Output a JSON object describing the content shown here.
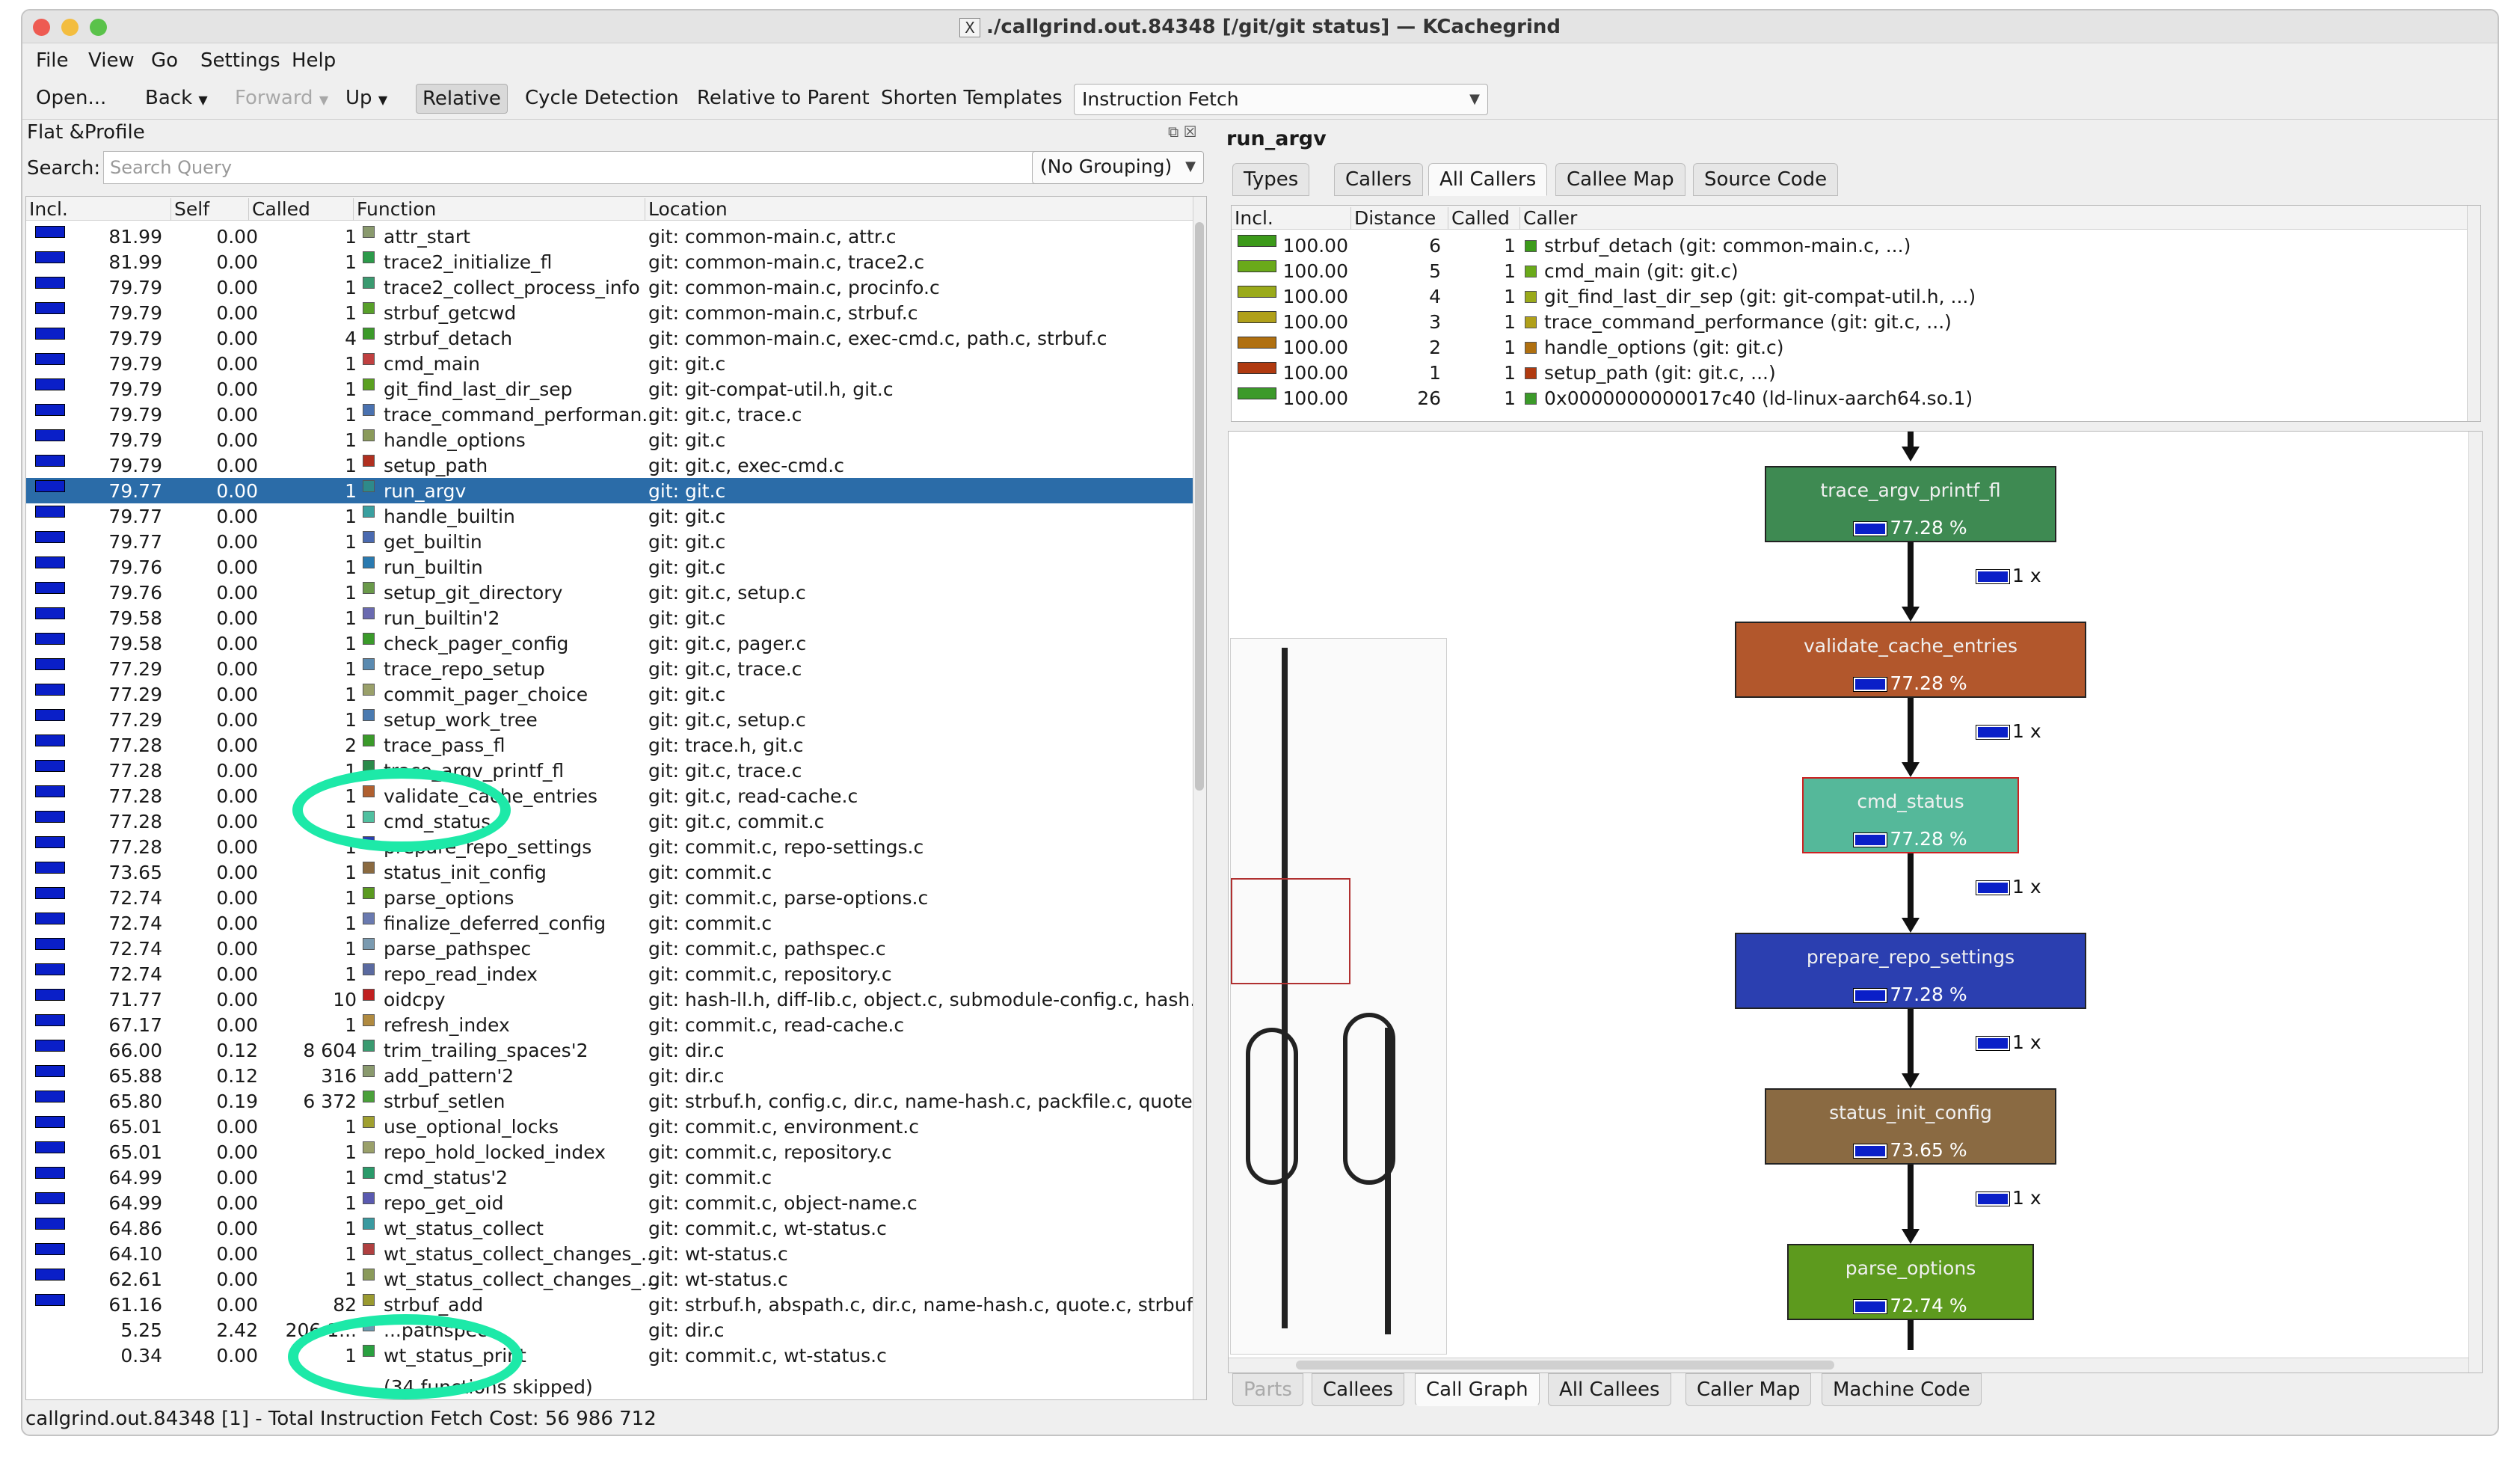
{
  "window": {
    "title": "./callgrind.out.84348 [/git/git status] — KCachegrind",
    "x_glyph": "X"
  },
  "menu": [
    "File",
    "View",
    "Go",
    "Settings",
    "Help"
  ],
  "toolbar": {
    "open": "Open...",
    "back": "Back",
    "forward": "Forward",
    "up": "Up",
    "relative": "Relative",
    "cycle": "Cycle Detection",
    "relative_parent": "Relative to Parent",
    "shorten": "Shorten Templates",
    "event_type": "Instruction Fetch"
  },
  "left": {
    "title": "Flat &Profile",
    "search_label": "Search:",
    "search_placeholder": "Search Query",
    "grouping": "(No Grouping)",
    "headers": [
      "Incl.",
      "Self",
      "Called",
      "Function",
      "Location"
    ],
    "rows": [
      {
        "incl": "81.99",
        "self": "0.00",
        "called": "1",
        "fn": "attr_start",
        "loc": "git: common-main.c, attr.c",
        "color": "#8a9a6e"
      },
      {
        "incl": "81.99",
        "self": "0.00",
        "called": "1",
        "fn": "trace2_initialize_fl",
        "loc": "git: common-main.c, trace2.c",
        "color": "#2c9a4a"
      },
      {
        "incl": "79.79",
        "self": "0.00",
        "called": "1",
        "fn": "trace2_collect_process_info",
        "loc": "git: common-main.c, procinfo.c",
        "color": "#3a9a70"
      },
      {
        "incl": "79.79",
        "self": "0.00",
        "called": "1",
        "fn": "strbuf_getcwd",
        "loc": "git: common-main.c, strbuf.c",
        "color": "#58a02a"
      },
      {
        "incl": "79.79",
        "self": "0.00",
        "called": "4",
        "fn": "strbuf_detach",
        "loc": "git: common-main.c, exec-cmd.c, path.c, strbuf.c",
        "color": "#3c9a2a"
      },
      {
        "incl": "79.79",
        "self": "0.00",
        "called": "1",
        "fn": "cmd_main",
        "loc": "git: git.c",
        "color": "#c04040"
      },
      {
        "incl": "79.79",
        "self": "0.00",
        "called": "1",
        "fn": "git_find_last_dir_sep",
        "loc": "git: git-compat-util.h, git.c",
        "color": "#5aa020"
      },
      {
        "incl": "79.79",
        "self": "0.00",
        "called": "1",
        "fn": "trace_command_performan...",
        "loc": "git: git.c, trace.c",
        "color": "#4a72b0"
      },
      {
        "incl": "79.79",
        "self": "0.00",
        "called": "1",
        "fn": "handle_options",
        "loc": "git: git.c",
        "color": "#8a9a5a"
      },
      {
        "incl": "79.79",
        "self": "0.00",
        "called": "1",
        "fn": "setup_path",
        "loc": "git: git.c, exec-cmd.c",
        "color": "#b03020"
      },
      {
        "incl": "79.77",
        "self": "0.00",
        "called": "1",
        "fn": "run_argv",
        "loc": "git: git.c",
        "color": "#2e8a8a"
      },
      {
        "incl": "79.77",
        "self": "0.00",
        "called": "1",
        "fn": "handle_builtin",
        "loc": "git: git.c",
        "color": "#3aa0a0"
      },
      {
        "incl": "79.77",
        "self": "0.00",
        "called": "1",
        "fn": "get_builtin",
        "loc": "git: git.c",
        "color": "#4a6ab0"
      },
      {
        "incl": "79.76",
        "self": "0.00",
        "called": "1",
        "fn": "run_builtin",
        "loc": "git: git.c",
        "color": "#2a7ab0"
      },
      {
        "incl": "79.76",
        "self": "0.00",
        "called": "1",
        "fn": "setup_git_directory",
        "loc": "git: git.c, setup.c",
        "color": "#6a9a4a"
      },
      {
        "incl": "79.58",
        "self": "0.00",
        "called": "1",
        "fn": "run_builtin'2",
        "loc": "git: git.c",
        "color": "#6a6ab0"
      },
      {
        "incl": "79.58",
        "self": "0.00",
        "called": "1",
        "fn": "check_pager_config",
        "loc": "git: git.c, pager.c",
        "color": "#3a9a2a"
      },
      {
        "incl": "77.29",
        "self": "0.00",
        "called": "1",
        "fn": "trace_repo_setup",
        "loc": "git: git.c, trace.c",
        "color": "#5a8ab0"
      },
      {
        "incl": "77.29",
        "self": "0.00",
        "called": "1",
        "fn": "commit_pager_choice",
        "loc": "git: git.c",
        "color": "#9aa06a"
      },
      {
        "incl": "77.29",
        "self": "0.00",
        "called": "1",
        "fn": "setup_work_tree",
        "loc": "git: git.c, setup.c",
        "color": "#4a7ab0"
      },
      {
        "incl": "77.28",
        "self": "0.00",
        "called": "2",
        "fn": "trace_pass_fl",
        "loc": "git: trace.h, git.c",
        "color": "#3a9a2a"
      },
      {
        "incl": "77.28",
        "self": "0.00",
        "called": "1",
        "fn": "trace_argv_printf_fl",
        "loc": "git: git.c, trace.c",
        "color": "#2a8a4a"
      },
      {
        "incl": "77.28",
        "self": "0.00",
        "called": "1",
        "fn": "validate_cache_entries",
        "loc": "git: git.c, read-cache.c",
        "color": "#b06030"
      },
      {
        "incl": "77.28",
        "self": "0.00",
        "called": "1",
        "fn": "cmd_status",
        "loc": "git: git.c, commit.c",
        "color": "#50c0a0"
      },
      {
        "incl": "77.28",
        "self": "0.00",
        "called": "1",
        "fn": "prepare_repo_settings",
        "loc": "git: commit.c, repo-settings.c",
        "color": "#2a40b0"
      },
      {
        "incl": "73.65",
        "self": "0.00",
        "called": "1",
        "fn": "status_init_config",
        "loc": "git: commit.c",
        "color": "#8a6a40"
      },
      {
        "incl": "72.74",
        "self": "0.00",
        "called": "1",
        "fn": "parse_options",
        "loc": "git: commit.c, parse-options.c",
        "color": "#5a9a20"
      },
      {
        "incl": "72.74",
        "self": "0.00",
        "called": "1",
        "fn": "finalize_deferred_config",
        "loc": "git: commit.c",
        "color": "#6a7ab0"
      },
      {
        "incl": "72.74",
        "self": "0.00",
        "called": "1",
        "fn": "parse_pathspec",
        "loc": "git: commit.c, pathspec.c",
        "color": "#7a9ab0"
      },
      {
        "incl": "72.74",
        "self": "0.00",
        "called": "1",
        "fn": "repo_read_index",
        "loc": "git: commit.c, repository.c",
        "color": "#5a6aa0"
      },
      {
        "incl": "71.77",
        "self": "0.00",
        "called": "10",
        "fn": "oidcpy",
        "loc": "git: hash-ll.h, diff-lib.c, object.c, submodule-config.c, hash...",
        "color": "#c02020"
      },
      {
        "incl": "67.17",
        "self": "0.00",
        "called": "1",
        "fn": "refresh_index",
        "loc": "git: commit.c, read-cache.c",
        "color": "#b08a40"
      },
      {
        "incl": "66.00",
        "self": "0.12",
        "called": "8 604",
        "fn": "trim_trailing_spaces'2",
        "loc": "git: dir.c",
        "color": "#3a9a70"
      },
      {
        "incl": "65.88",
        "self": "0.12",
        "called": "316",
        "fn": "add_pattern'2",
        "loc": "git: dir.c",
        "color": "#8a9a6e"
      },
      {
        "incl": "65.80",
        "self": "0.19",
        "called": "6 372",
        "fn": "strbuf_setlen",
        "loc": "git: strbuf.h, config.c, dir.c, name-hash.c, packfile.c, quote...",
        "color": "#4aa03a"
      },
      {
        "incl": "65.01",
        "self": "0.00",
        "called": "1",
        "fn": "use_optional_locks",
        "loc": "git: commit.c, environment.c",
        "color": "#a0a030"
      },
      {
        "incl": "65.01",
        "self": "0.00",
        "called": "1",
        "fn": "repo_hold_locked_index",
        "loc": "git: commit.c, repository.c",
        "color": "#9aa06a"
      },
      {
        "incl": "64.99",
        "self": "0.00",
        "called": "1",
        "fn": "cmd_status'2",
        "loc": "git: commit.c",
        "color": "#2a9a6a"
      },
      {
        "incl": "64.99",
        "self": "0.00",
        "called": "1",
        "fn": "repo_get_oid",
        "loc": "git: commit.c, object-name.c",
        "color": "#5a5ab0"
      },
      {
        "incl": "64.86",
        "self": "0.00",
        "called": "1",
        "fn": "wt_status_collect",
        "loc": "git: commit.c, wt-status.c",
        "color": "#3a9aa0"
      },
      {
        "incl": "64.10",
        "self": "0.00",
        "called": "1",
        "fn": "wt_status_collect_changes_...",
        "loc": "git: wt-status.c",
        "color": "#b04040"
      },
      {
        "incl": "62.61",
        "self": "0.00",
        "called": "1",
        "fn": "wt_status_collect_changes_...",
        "loc": "git: wt-status.c",
        "color": "#8a9a5a"
      },
      {
        "incl": "61.16",
        "self": "0.00",
        "called": "82",
        "fn": "strbuf_add",
        "loc": "git: strbuf.h, abspath.c, dir.c, name-hash.c, quote.c, strbuf...",
        "color": "#9a9a30"
      },
      {
        "incl": "5.25",
        "self": "2.42",
        "called": "206 1...",
        "fn": "...pathspec...",
        "loc": "git: dir.c",
        "color": "#6a9ab0"
      },
      {
        "incl": "0.34",
        "self": "0.00",
        "called": "1",
        "fn": "wt_status_print",
        "loc": "git: commit.c, wt-status.c",
        "color": "#2aa040"
      }
    ],
    "truncated_note": "(34 functions skipped)"
  },
  "status": "callgrind.out.84348 [1] - Total Instruction Fetch Cost: 56 986 712",
  "right": {
    "title": "run_argv",
    "top_tabs": [
      "Types",
      "Callers",
      "All Callers",
      "Callee Map",
      "Source Code"
    ],
    "callers_headers": [
      "Incl.",
      "Distance",
      "Called",
      "Caller"
    ],
    "callers": [
      {
        "incl": "100.00",
        "dist": "6",
        "called": "1",
        "caller": "strbuf_detach (git: common-main.c, ...)",
        "color": "#3c9a1a"
      },
      {
        "incl": "100.00",
        "dist": "5",
        "called": "1",
        "caller": "cmd_main (git: git.c)",
        "color": "#6aaa1a"
      },
      {
        "incl": "100.00",
        "dist": "4",
        "called": "1",
        "caller": "git_find_last_dir_sep (git: git-compat-util.h, ...)",
        "color": "#9aaa1a"
      },
      {
        "incl": "100.00",
        "dist": "3",
        "called": "1",
        "caller": "trace_command_performance (git: git.c, ...)",
        "color": "#b0a01a"
      },
      {
        "incl": "100.00",
        "dist": "2",
        "called": "1",
        "caller": "handle_options (git: git.c)",
        "color": "#b07010"
      },
      {
        "incl": "100.00",
        "dist": "1",
        "called": "1",
        "caller": "setup_path (git: git.c, ...)",
        "color": "#b03a10"
      },
      {
        "incl": "100.00",
        "dist": "26",
        "called": "1",
        "caller": "0x0000000000017c40 (ld-linux-aarch64.so.1)",
        "color": "#3c9a2a"
      }
    ],
    "graph": {
      "nodes": [
        {
          "name": "trace_argv_printf_fl",
          "pct": "77.28 %",
          "color": "#3e8a52",
          "border": "#222"
        },
        {
          "name": "validate_cache_entries",
          "pct": "77.28 %",
          "color": "#b2572c",
          "border": "#222"
        },
        {
          "name": "cmd_status",
          "pct": "77.28 %",
          "color": "#55b89a",
          "border": "#cc2222"
        },
        {
          "name": "prepare_repo_settings",
          "pct": "77.28 %",
          "color": "#2b3fb0",
          "border": "#222"
        },
        {
          "name": "status_init_config",
          "pct": "73.65 %",
          "color": "#8a6a42",
          "border": "#222"
        },
        {
          "name": "parse_options",
          "pct": "72.74 %",
          "color": "#5d9a1e",
          "border": "#222"
        }
      ],
      "edge_label": "1 x"
    },
    "bottom_tabs": [
      "Parts",
      "Callees",
      "Call Graph",
      "All Callees",
      "Caller Map",
      "Machine Code"
    ]
  }
}
